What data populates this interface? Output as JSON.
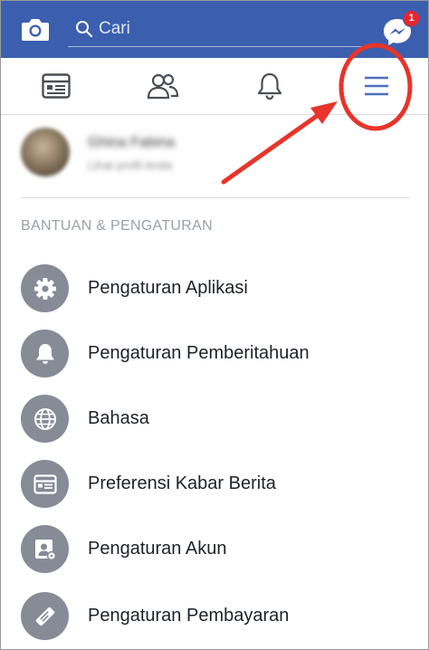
{
  "colors": {
    "brand_blue": "#3b5fae",
    "tab_active": "#4a6fc0",
    "icon_circle": "#868b96",
    "badge_red": "#e8262e",
    "annotation_red": "#e8342a"
  },
  "header": {
    "camera_icon": "camera-icon",
    "search": {
      "placeholder": "Cari",
      "value": ""
    },
    "messenger": {
      "icon": "messenger-icon",
      "badge_count": "1"
    }
  },
  "tabs": [
    {
      "name": "news-feed",
      "icon": "news-feed-icon",
      "active": false
    },
    {
      "name": "friends",
      "icon": "friends-icon",
      "active": false
    },
    {
      "name": "notifications",
      "icon": "bell-icon",
      "active": false
    },
    {
      "name": "menu",
      "icon": "hamburger-menu-icon",
      "active": true
    }
  ],
  "profile": {
    "name": "Ghina Fabina",
    "subtitle": "Lihat profil Anda",
    "blurred": true
  },
  "section": {
    "header": "BANTUAN & PENGATURAN"
  },
  "menu": {
    "items": [
      {
        "label": "Pengaturan Aplikasi",
        "icon": "gear-icon"
      },
      {
        "label": "Pengaturan Pemberitahuan",
        "icon": "bell-icon"
      },
      {
        "label": "Bahasa",
        "icon": "globe-icon"
      },
      {
        "label": "Preferensi Kabar Berita",
        "icon": "news-feed-icon"
      },
      {
        "label": "Pengaturan Akun",
        "icon": "account-settings-icon"
      },
      {
        "label": "Pengaturan Pembayaran",
        "icon": "payment-tag-icon"
      }
    ]
  },
  "annotation": {
    "type": "red-arrow-and-circle",
    "target": "menu-tab"
  }
}
